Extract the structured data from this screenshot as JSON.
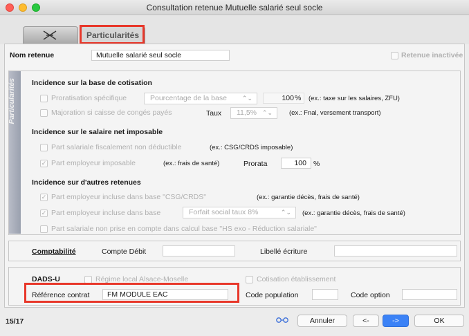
{
  "window": {
    "title": "Consultation retenue Mutuelle salarié seul socle"
  },
  "tabs": {
    "particularites": "Particularités"
  },
  "header": {
    "nom_retenue_label": "Nom retenue",
    "nom_retenue_value": "Mutuelle salarié seul socle",
    "retenue_inactivee": "Retenue inactivée"
  },
  "side_label": "Particularités",
  "base_cotisation": {
    "title": "Incidence sur la base de cotisation",
    "proratisation_label": "Proratisation spécifique",
    "proratisation_select": "Pourcentage de la base",
    "proratisation_value": "100",
    "proratisation_unit": "%",
    "proratisation_hint": "(ex.: taxe sur les salaires, ZFU)",
    "majoration_label": "Majoration si caisse de congés payés",
    "taux_label": "Taux",
    "taux_value": "11,5%",
    "majoration_hint": "(ex.: Fnal, versement transport)"
  },
  "net_imposable": {
    "title": "Incidence sur le salaire net imposable",
    "part_salariale_label": "Part salariale fiscalement non déductible",
    "part_salariale_hint": "(ex.: CSG/CRDS imposable)",
    "part_employeur_label": "Part employeur imposable",
    "part_employeur_hint": "(ex.: frais de santé)",
    "prorata_label": "Prorata",
    "prorata_value": "100",
    "prorata_unit": "%"
  },
  "autres_retenues": {
    "title": "Incidence sur d'autres retenues",
    "csg_label": "Part employeur incluse dans base \"CSG/CRDS\"",
    "csg_hint": "(ex.: garantie décès, frais de santé)",
    "base_label": "Part employeur incluse dans base",
    "base_select": "Forfait social taux 8%",
    "base_hint": "(ex.: garantie décès, frais de santé)",
    "hs_label": "Part salariale non prise en compte dans calcul base \"HS exo - Réduction salariale\""
  },
  "comptabilite": {
    "title": "Comptabilité",
    "compte_debit_label": "Compte Débit",
    "compte_debit_value": "",
    "libelle_label": "Libellé écriture",
    "libelle_value": ""
  },
  "dadsu": {
    "title": "DADS-U",
    "regime_label": "Régime local Alsace-Moselle",
    "cotisation_label": "Cotisation établissement",
    "reference_label": "Référence contrat",
    "reference_value": "FM MODULE EAC",
    "code_population_label": "Code population",
    "code_population_value": "",
    "code_option_label": "Code option",
    "code_option_value": ""
  },
  "footer": {
    "page_counter": "15/17",
    "annuler": "Annuler",
    "prev": "<-",
    "next": "->",
    "ok": "OK"
  },
  "colors": {
    "highlight_red": "#e8372a",
    "accent_blue": "#3b82f6"
  },
  "icons": [
    "close-dot",
    "minimize-dot",
    "zoom-dot",
    "tools-icon",
    "glasses-icon",
    "stepper-icon",
    "checkmark"
  ]
}
